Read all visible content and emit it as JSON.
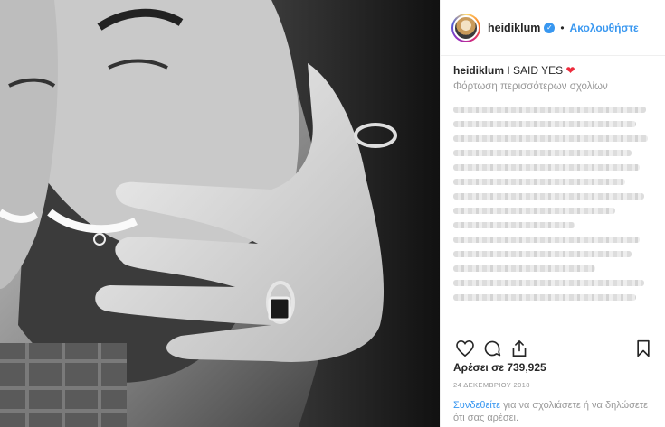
{
  "post": {
    "image_description_icon": "photo-bw-couple-hand-ring",
    "username": "heidiklum",
    "verified_icon": "verified-badge-icon",
    "follow_label": "Ακολουθήστε",
    "caption_user": "heidiklum",
    "caption_text": "I SAID YES",
    "caption_emoji": "❤",
    "load_more": "Φόρτωση περισσότερων σχολίων",
    "likes_label": "Αρέσει σε 739,925",
    "date": "24 ΔΕΚΕΜΒΡΙΟΥ 2018",
    "login_link": "Συνδεθείτε",
    "login_text": " για να σχολιάσετε ή να δηλώσετε ότι σας αρέσει."
  },
  "colors": {
    "link_blue": "#3897f0",
    "heart_red": "#ed2b3c",
    "muted_gray": "#999999"
  }
}
